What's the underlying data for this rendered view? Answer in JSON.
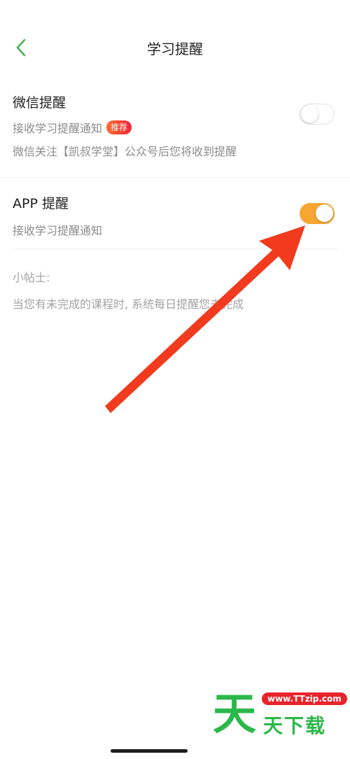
{
  "header": {
    "title": "学习提醒",
    "back_icon": "chevron-left-icon"
  },
  "wechat_reminder": {
    "title": "微信提醒",
    "subtitle": "接收学习提醒通知",
    "badge": "推荐",
    "description": "微信关注【凯叔学堂】公众号后您将收到提醒",
    "enabled": false
  },
  "app_reminder": {
    "title": "APP 提醒",
    "subtitle": "接收学习提醒通知",
    "enabled": true
  },
  "tips": {
    "label": "小帖士:",
    "text": "当您有未完成的课程时, 系统每日提醒您去完成"
  },
  "watermark": {
    "url": "www.TTzip.com",
    "big_char": "天",
    "text": "天下载"
  },
  "colors": {
    "accent_green": "#4cb050",
    "toggle_on": "#f7a632",
    "badge_red": "#f2243a",
    "annotation_arrow": "#f23b1e",
    "watermark_green": "#2bb84a"
  }
}
